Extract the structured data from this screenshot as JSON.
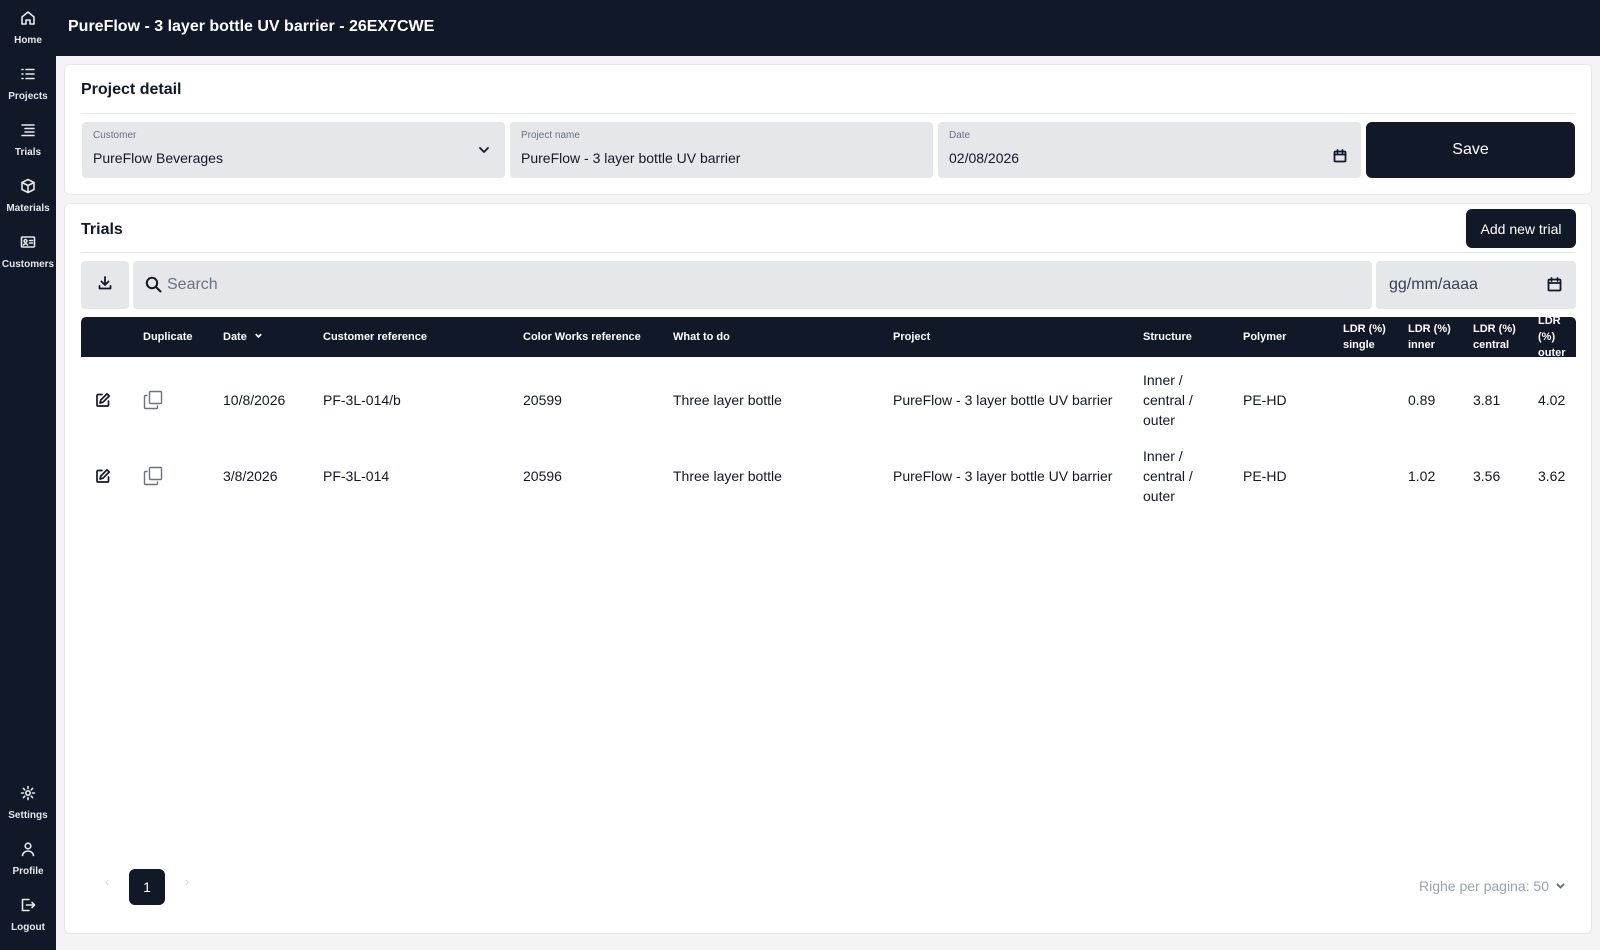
{
  "sidebar": {
    "items": [
      {
        "label": "Home",
        "icon": "home-icon"
      },
      {
        "label": "Projects",
        "icon": "list-icon"
      },
      {
        "label": "Trials",
        "icon": "list-tree-icon"
      },
      {
        "label": "Materials",
        "icon": "cube-icon"
      },
      {
        "label": "Customers",
        "icon": "id-card-icon"
      }
    ],
    "bottom_items": [
      {
        "label": "Settings",
        "icon": "gear-icon"
      },
      {
        "label": "Profile",
        "icon": "user-icon"
      },
      {
        "label": "Logout",
        "icon": "logout-icon"
      }
    ]
  },
  "header": {
    "title": "PureFlow - 3 layer bottle UV barrier - 26EX7CWE"
  },
  "project_detail": {
    "title": "Project detail",
    "customer": {
      "label": "Customer",
      "value": "PureFlow Beverages"
    },
    "project_name": {
      "label": "Project name",
      "value": "PureFlow - 3 layer bottle UV barrier"
    },
    "date": {
      "label": "Date",
      "value": "02/08/2026"
    },
    "save_label": "Save"
  },
  "trials": {
    "title": "Trials",
    "add_label": "Add new trial",
    "search_placeholder": "Search",
    "date_filter_placeholder": "gg/mm/aaaa",
    "columns": {
      "duplicate": "Duplicate",
      "date": "Date",
      "customer_reference": "Customer reference",
      "color_works_reference": "Color Works reference",
      "what_to_do": "What to do",
      "project": "Project",
      "structure": "Structure",
      "polymer": "Polymer",
      "ldr_single": [
        "LDR (%)",
        "single"
      ],
      "ldr_inner": [
        "LDR (%)",
        "inner"
      ],
      "ldr_central": [
        "LDR (%)",
        "central"
      ],
      "ldr_outer": [
        "LDR (%)",
        "outer"
      ]
    },
    "rows": [
      {
        "date": "10/8/2026",
        "customer_reference": "PF-3L-014/b",
        "color_works_reference": "20599",
        "what_to_do": "Three layer bottle",
        "project": "PureFlow - 3 layer bottle UV barrier",
        "structure": [
          "Inner /",
          "central /",
          "outer"
        ],
        "polymer": "PE-HD",
        "ldr_single": "",
        "ldr_inner": "0.89",
        "ldr_central": "3.81",
        "ldr_outer": "4.02"
      },
      {
        "date": "3/8/2026",
        "customer_reference": "PF-3L-014",
        "color_works_reference": "20596",
        "what_to_do": "Three layer bottle",
        "project": "PureFlow - 3 layer bottle UV barrier",
        "structure": [
          "Inner /",
          "central /",
          "outer"
        ],
        "polymer": "PE-HD",
        "ldr_single": "",
        "ldr_inner": "1.02",
        "ldr_central": "3.56",
        "ldr_outer": "3.62"
      }
    ]
  },
  "pagination": {
    "current_page": "1",
    "rows_per_page": "Righe per pagina: 50"
  }
}
